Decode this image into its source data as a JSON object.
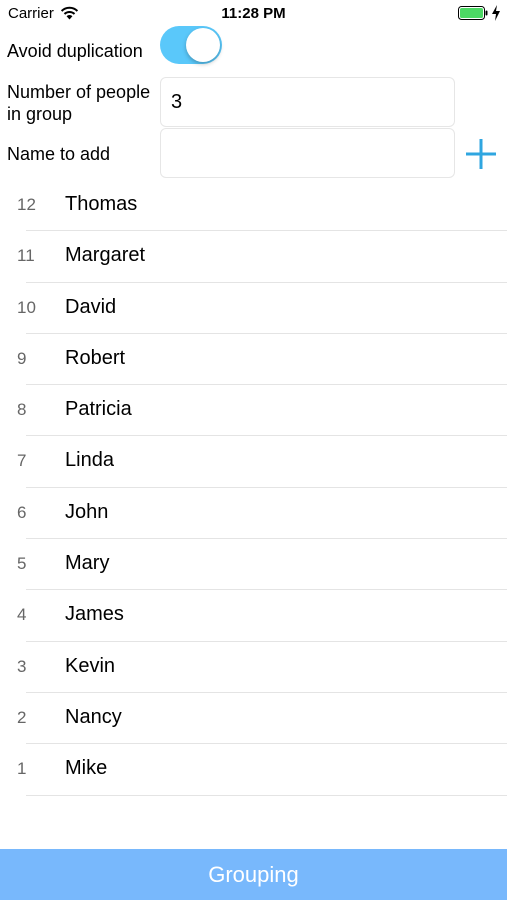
{
  "status_bar": {
    "carrier": "Carrier",
    "time": "11:28 PM",
    "battery_color": "#4cd964"
  },
  "form": {
    "avoid_duplication_label": "Avoid duplication",
    "avoid_duplication_on": true,
    "people_label_line1": "Number of people",
    "people_label_line2": "in group",
    "people_value": "3",
    "name_label": "Name to add",
    "name_value": "",
    "name_placeholder": "",
    "add_icon": "plus-icon"
  },
  "people": [
    {
      "number": "12",
      "name": "Thomas"
    },
    {
      "number": "11",
      "name": "Margaret"
    },
    {
      "number": "10",
      "name": "David"
    },
    {
      "number": "9",
      "name": "Robert"
    },
    {
      "number": "8",
      "name": "Patricia"
    },
    {
      "number": "7",
      "name": "Linda"
    },
    {
      "number": "6",
      "name": "John"
    },
    {
      "number": "5",
      "name": "Mary"
    },
    {
      "number": "4",
      "name": "James"
    },
    {
      "number": "3",
      "name": "Kevin"
    },
    {
      "number": "2",
      "name": "Nancy"
    },
    {
      "number": "1",
      "name": "Mike"
    }
  ],
  "grouping_button": {
    "label": "Grouping"
  },
  "colors": {
    "accent": "#5ac8fa",
    "plus": "#2fa6e0",
    "button": "#78b8fc"
  }
}
